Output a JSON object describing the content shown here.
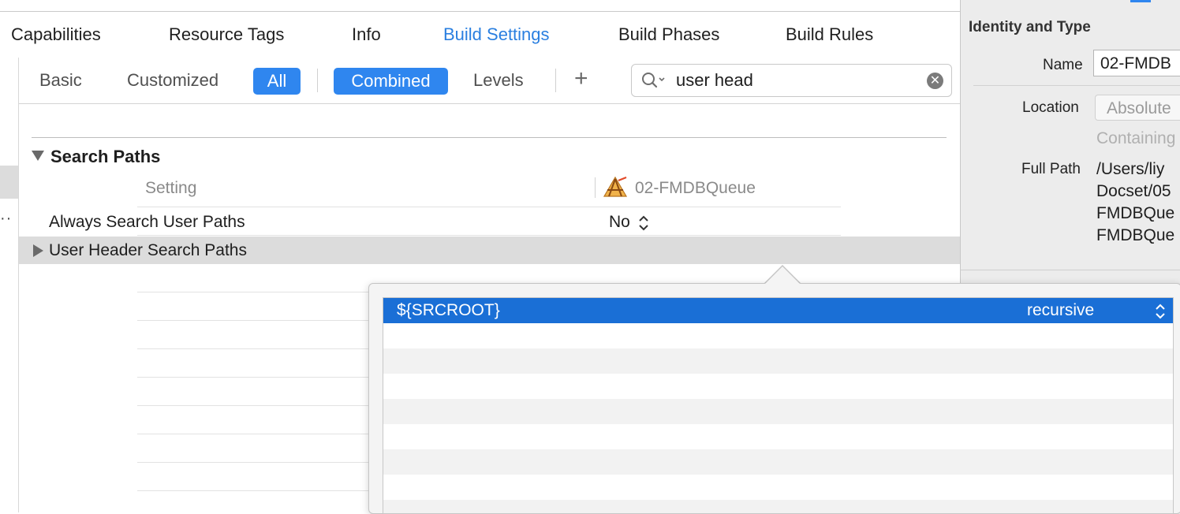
{
  "tabs": [
    {
      "label": "Capabilities",
      "active": false
    },
    {
      "label": "Resource Tags",
      "active": false
    },
    {
      "label": "Info",
      "active": false
    },
    {
      "label": "Build Settings",
      "active": true
    },
    {
      "label": "Build Phases",
      "active": false
    },
    {
      "label": "Build Rules",
      "active": false
    }
  ],
  "filter": {
    "basic": "Basic",
    "customized": "Customized",
    "all": "All",
    "combined": "Combined",
    "levels": "Levels",
    "plus": "+",
    "search_value": "user head"
  },
  "section": {
    "title": "Search Paths",
    "col_setting": "Setting",
    "col_target": "02-FMDBQueue",
    "rows": [
      {
        "label": "Always Search User Paths",
        "value": "No"
      },
      {
        "label": "User Header Search Paths",
        "value": ""
      }
    ]
  },
  "inspector": {
    "title": "Identity and Type",
    "name_label": "Name",
    "name_value": "02-FMDB",
    "location_label": "Location",
    "location_value": "Absolute",
    "location_sub": "Containing",
    "full_path_label": "Full Path",
    "full_path_lines": [
      "/Users/liy",
      "Docset/05",
      "FMDBQue",
      "FMDBQue"
    ]
  },
  "popover": {
    "path": "${SRCROOT}",
    "mode": "recursive"
  },
  "colors": {
    "accent": "#2f86ef",
    "selection": "#1a6fd6",
    "active_tab": "#2a7fe0"
  }
}
